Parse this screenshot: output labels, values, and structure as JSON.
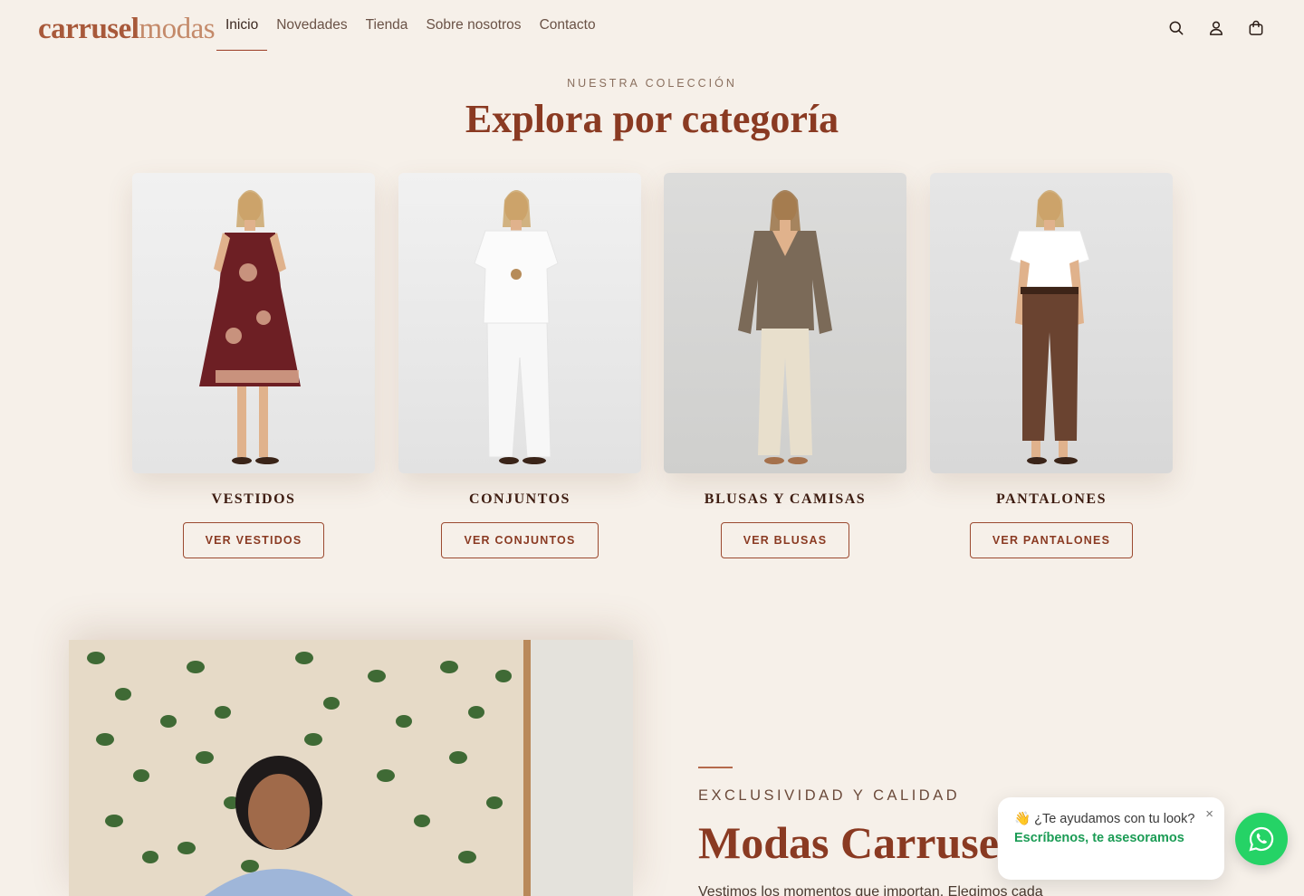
{
  "header": {
    "logo_part1": "carrusel",
    "logo_part2": "modas",
    "nav": [
      "Inicio",
      "Novedades",
      "Tienda",
      "Sobre nosotros",
      "Contacto"
    ],
    "icons": [
      "search-icon",
      "user-icon",
      "bag-icon"
    ]
  },
  "collection": {
    "eyebrow": "NUESTRA COLECCIÓN",
    "title": "Explora por categoría",
    "categories": [
      {
        "name": "VESTIDOS",
        "button": "VER VESTIDOS"
      },
      {
        "name": "CONJUNTOS",
        "button": "VER CONJUNTOS"
      },
      {
        "name": "BLUSAS Y CAMISAS",
        "button": "VER BLUSAS"
      },
      {
        "name": "PANTALONES",
        "button": "VER PANTALONES"
      }
    ]
  },
  "about": {
    "eyebrow": "EXCLUSIVIDAD Y CALIDAD",
    "title": "Modas Carrusel",
    "text": "Vestimos los momentos que importan. Elegimos cada"
  },
  "chat": {
    "emoji": "👋",
    "text": "¿Te ayudamos con tu look?",
    "highlight": "Escríbenos, te asesoramos",
    "close": "×"
  },
  "colors": {
    "background": "#f6f0e9",
    "accent": "#8a3a22",
    "whatsapp": "#25d366"
  }
}
